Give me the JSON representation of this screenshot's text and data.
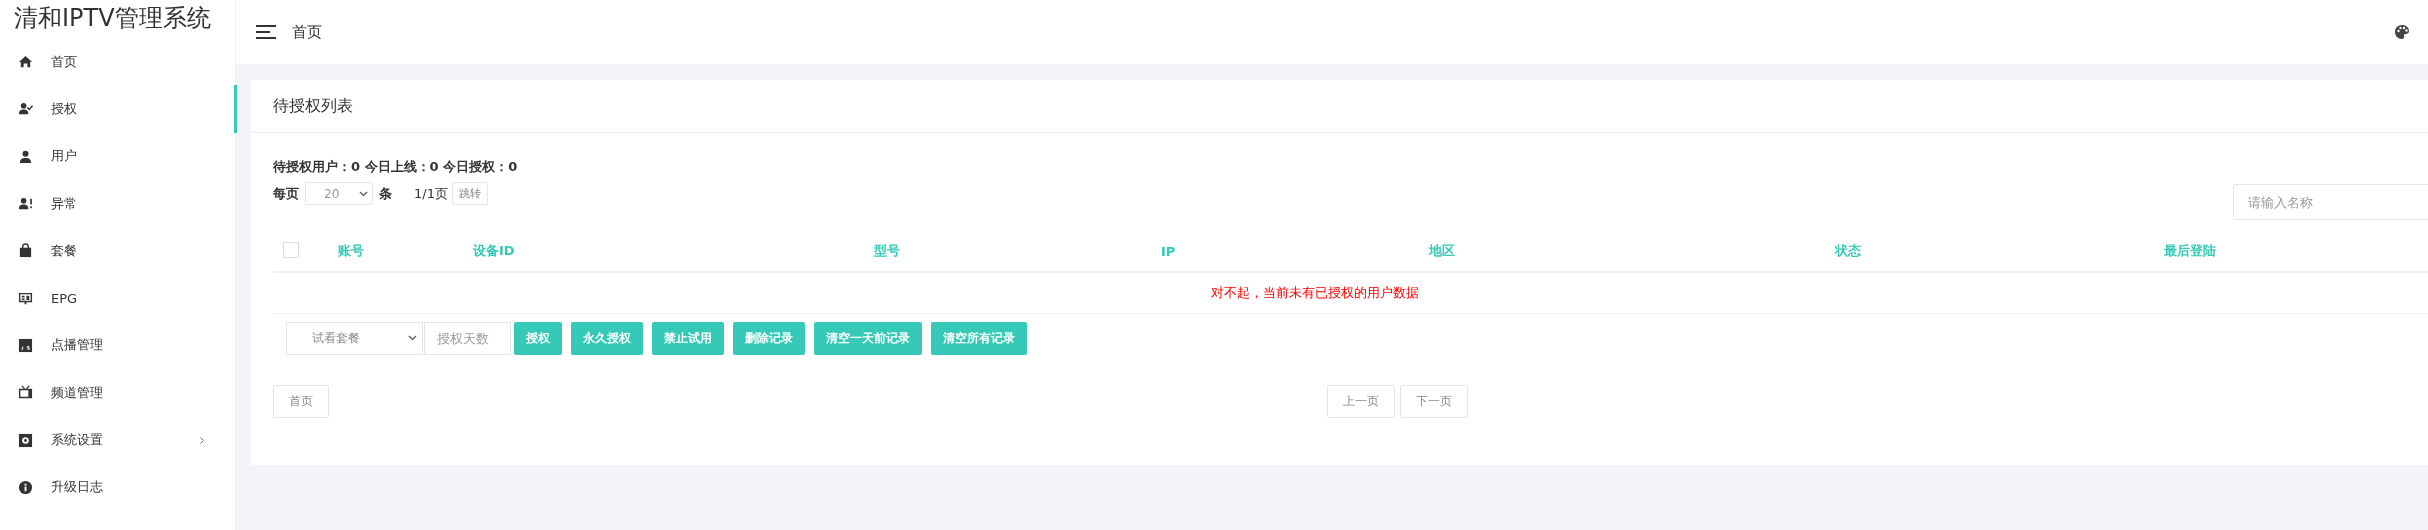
{
  "app_title": "清和IPTV管理系统",
  "sidebar": {
    "items": [
      {
        "label": "首页",
        "selected": false,
        "has_children": false
      },
      {
        "label": "授权",
        "selected": true,
        "has_children": false
      },
      {
        "label": "用户",
        "selected": false,
        "has_children": false
      },
      {
        "label": "异常",
        "selected": false,
        "has_children": false
      },
      {
        "label": "套餐",
        "selected": false,
        "has_children": false
      },
      {
        "label": "EPG",
        "selected": false,
        "has_children": false
      },
      {
        "label": "点播管理",
        "selected": false,
        "has_children": false
      },
      {
        "label": "频道管理",
        "selected": false,
        "has_children": false
      },
      {
        "label": "系统设置",
        "selected": false,
        "has_children": true
      },
      {
        "label": "升级日志",
        "selected": false,
        "has_children": false
      }
    ]
  },
  "header": {
    "breadcrumb": "首页"
  },
  "card": {
    "title": "待授权列表",
    "stats": "待授权用户：0 今日上线：0 今日授权：0",
    "per_page": {
      "label": "每页",
      "value": "20",
      "unit": "条",
      "page_info": "1/1页",
      "jump_button": "跳转"
    },
    "search": {
      "placeholder": "请输入名称"
    },
    "table": {
      "select_all": {
        "checked": false
      },
      "columns": [
        "账号",
        "设备ID",
        "型号",
        "IP",
        "地区",
        "状态",
        "最后登陆"
      ],
      "empty_message": "对不起，当前未有已授权的用户数据"
    },
    "actions": {
      "package_select": "试看套餐",
      "days_placeholder": "授权天数",
      "buttons": [
        "授权",
        "永久授权",
        "禁止试用",
        "删除记录",
        "清空一天前记录",
        "清空所有记录"
      ]
    },
    "pager": {
      "first": "首页",
      "prev": "上一页",
      "next": "下一页"
    }
  }
}
